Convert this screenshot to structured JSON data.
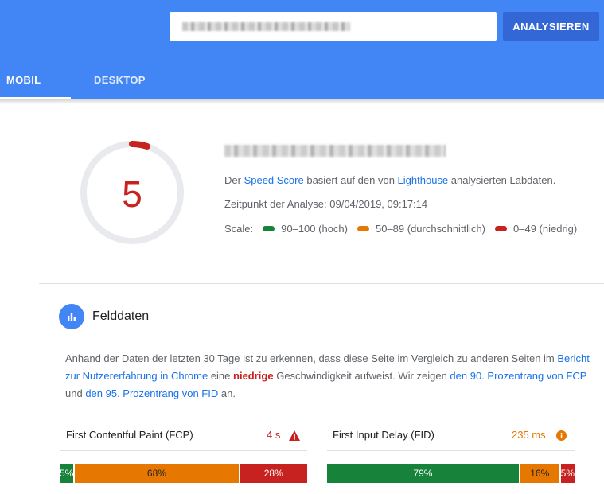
{
  "header": {
    "analyze_label": "ANALYSIEREN",
    "tabs": [
      {
        "label": "MOBIL",
        "active": true
      },
      {
        "label": "DESKTOP",
        "active": false
      }
    ]
  },
  "summary": {
    "score": "5",
    "score_progress": 0.05,
    "score_color": "#c7221f",
    "speed_line": {
      "t1": "Der ",
      "speed_score_link": "Speed Score",
      "t2": " basiert auf den von ",
      "lighthouse_link": "Lighthouse",
      "t3": " analysierten Labdaten."
    },
    "analysis_time": "Zeitpunkt der Analyse: 09/04/2019, 09:17:14",
    "scale": {
      "label": "Scale:",
      "items": [
        {
          "label": "90–100 (hoch)",
          "color": "#178239"
        },
        {
          "label": "50–89 (durchschnittlich)",
          "color": "#e67700"
        },
        {
          "label": "0–49 (niedrig)",
          "color": "#c7221f"
        }
      ]
    }
  },
  "field_data": {
    "icon": "bar-chart-icon",
    "title": "Felddaten",
    "para": {
      "t1": "Anhand der Daten der letzten 30 Tage ist zu erkennen, dass diese Seite im Vergleich zu anderen Seiten im ",
      "crux_link": "Bericht zur Nutzererfahrung in Chrome",
      "t2": " eine ",
      "rating": "niedrige",
      "t3": " Geschwindigkeit aufweist. Wir zeigen ",
      "fcp_link": "den 90. Prozentrang von FCP",
      "t4": " und ",
      "fid_link": "den 95. Prozentrang von FID",
      "t5": " an."
    },
    "metrics": [
      {
        "name": "First Contentful Paint (FCP)",
        "value": "4 s",
        "value_color": "#c7221f",
        "status_icon": "warning-triangle-icon",
        "distribution": [
          {
            "label": "5%",
            "value": 5,
            "color": "#178239"
          },
          {
            "label": "68%",
            "value": 68,
            "color": "#e67700"
          },
          {
            "label": "28%",
            "value": 28,
            "color": "#c7221f"
          }
        ]
      },
      {
        "name": "First Input Delay (FID)",
        "value": "235 ms",
        "value_color": "#e67700",
        "status_icon": "info-circle-icon",
        "distribution": [
          {
            "label": "79%",
            "value": 79,
            "color": "#178239"
          },
          {
            "label": "16%",
            "value": 16,
            "color": "#e67700"
          },
          {
            "label": "5%",
            "value": 5,
            "color": "#c7221f"
          }
        ]
      }
    ]
  }
}
